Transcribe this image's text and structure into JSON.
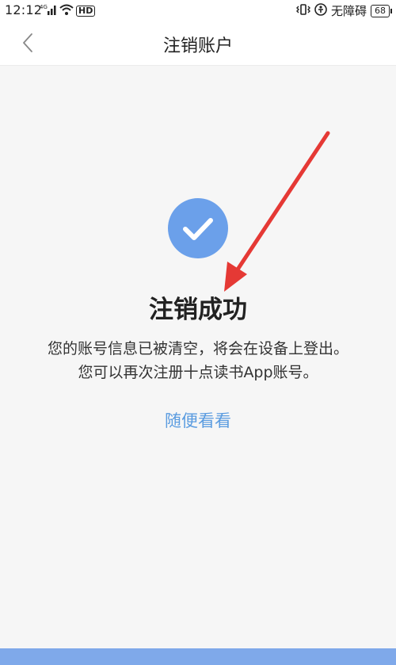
{
  "status_bar": {
    "time": "12:12",
    "network_type": "4G",
    "hd_label": "HD",
    "accessibility_text": "无障碍",
    "battery": "68"
  },
  "nav": {
    "title": "注销账户"
  },
  "main": {
    "success_title": "注销成功",
    "description_line1": "您的账号信息已被清空，将会在设备上登出。",
    "description_line2": "您可以再次注册十点读书App账号。",
    "browse_link": "随便看看"
  },
  "colors": {
    "accent": "#6ba0ea",
    "link": "#5b9ce0",
    "annotation_arrow": "#e53935",
    "background": "#f6f6f6"
  },
  "icons": [
    "back-chevron-icon",
    "check-icon",
    "signal-icon",
    "wifi-icon",
    "accessibility-icon",
    "battery-icon"
  ]
}
